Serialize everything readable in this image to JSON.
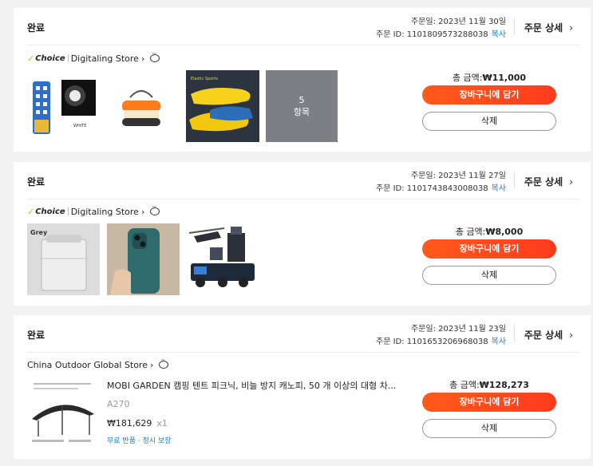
{
  "orders": [
    {
      "status": "완료",
      "order_date": "주문일: 2023년 11월 30일",
      "order_id": "주문 ID: 1101809573288038",
      "copy_label": "복사",
      "detail_label": "주문 상세",
      "store_choice": "Choice",
      "store_name": "Digitaling Store",
      "more_count": "5",
      "more_label": "항목",
      "total": "총 금액:",
      "total_value": "₩11,000",
      "cart_label": "장바구니에 담기",
      "delete_label": "삭제",
      "thumb_text": {
        "white": "WHITE",
        "insoles": "Elastic Sports"
      }
    },
    {
      "status": "완료",
      "order_date": "주문일: 2023년 11월 27일",
      "order_id": "주문 ID: 1101743843008038",
      "copy_label": "복사",
      "detail_label": "주문 상세",
      "store_choice": "Choice",
      "store_name": "Digitaling Store",
      "total": "총 금액:",
      "total_value": "₩8,000",
      "cart_label": "장바구니에 담기",
      "delete_label": "삭제",
      "thumb_text": {
        "grey": "Grey"
      }
    },
    {
      "status": "완료",
      "order_date": "주문일: 2023년 11월 23일",
      "order_id": "주문 ID: 1101653206968038",
      "copy_label": "복사",
      "detail_label": "주문 상세",
      "store_name": "China Outdoor Global Store",
      "product_title": "MOBI GARDEN 캠핑 텐트 피크닉, 비늘 방지 캐노피, 50 개 이상의 대형 차...",
      "product_sku": "A270",
      "product_price": "₩181,629",
      "product_qty": "x1",
      "product_perks": "무료 반품 · 정시 보장",
      "total": "총 금액:",
      "total_value": "₩128,273",
      "cart_label": "장바구니에 담기",
      "delete_label": "삭제"
    }
  ],
  "colors": {
    "accent": "#ff4c1b",
    "link": "#1a7bd8",
    "choice_check": "#f5a623",
    "background": "#f2f2f2"
  },
  "icons": {
    "chevron": "chevron-right-icon",
    "chat": "chat-icon",
    "choice": "choice-check-icon"
  }
}
